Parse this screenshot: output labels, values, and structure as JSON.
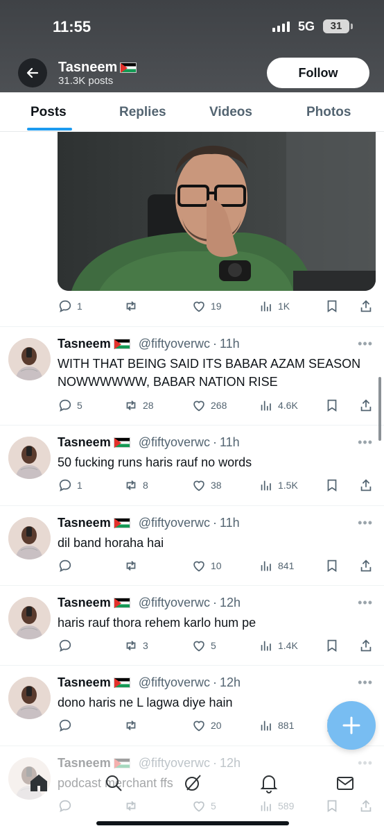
{
  "status_bar": {
    "time": "11:55",
    "network": "5G",
    "battery": "31"
  },
  "header": {
    "name": "Tasneem",
    "posts": "31.3K posts",
    "follow_label": "Follow"
  },
  "tabs": [
    {
      "label": "Posts",
      "active": true
    },
    {
      "label": "Replies",
      "active": false
    },
    {
      "label": "Videos",
      "active": false
    },
    {
      "label": "Photos",
      "active": false
    }
  ],
  "first_post_stats": {
    "replies": "1",
    "reposts": "",
    "likes": "19",
    "views": "1K"
  },
  "tweets": [
    {
      "name": "Tasneem",
      "handle": "@fiftyoverwc",
      "time": "11h",
      "text": "WITH THAT BEING SAID ITS BABAR AZAM SEASON NOWWWWWW, BABAR NATION RISE",
      "replies": "5",
      "reposts": "28",
      "likes": "268",
      "views": "4.6K"
    },
    {
      "name": "Tasneem",
      "handle": "@fiftyoverwc",
      "time": "11h",
      "text": "50 fucking runs haris rauf no words",
      "replies": "1",
      "reposts": "8",
      "likes": "38",
      "views": "1.5K"
    },
    {
      "name": "Tasneem",
      "handle": "@fiftyoverwc",
      "time": "11h",
      "text": "dil band horaha hai",
      "replies": "",
      "reposts": "",
      "likes": "10",
      "views": "841"
    },
    {
      "name": "Tasneem",
      "handle": "@fiftyoverwc",
      "time": "12h",
      "text": "haris rauf thora rehem karlo hum pe",
      "replies": "",
      "reposts": "3",
      "likes": "5",
      "views": "1.4K"
    },
    {
      "name": "Tasneem",
      "handle": "@fiftyoverwc",
      "time": "12h",
      "text": "dono haris ne L lagwa diye hain",
      "replies": "",
      "reposts": "",
      "likes": "20",
      "views": "881"
    },
    {
      "name": "Tasneem",
      "handle": "@fiftyoverwc",
      "time": "12h",
      "text": "podcast merchant ffs",
      "replies": "",
      "reposts": "",
      "likes": "5",
      "views": "589"
    }
  ],
  "nav": [
    "home-icon",
    "search-icon",
    "grok-icon",
    "notifications-icon",
    "messages-icon"
  ],
  "fab": "compose-icon"
}
